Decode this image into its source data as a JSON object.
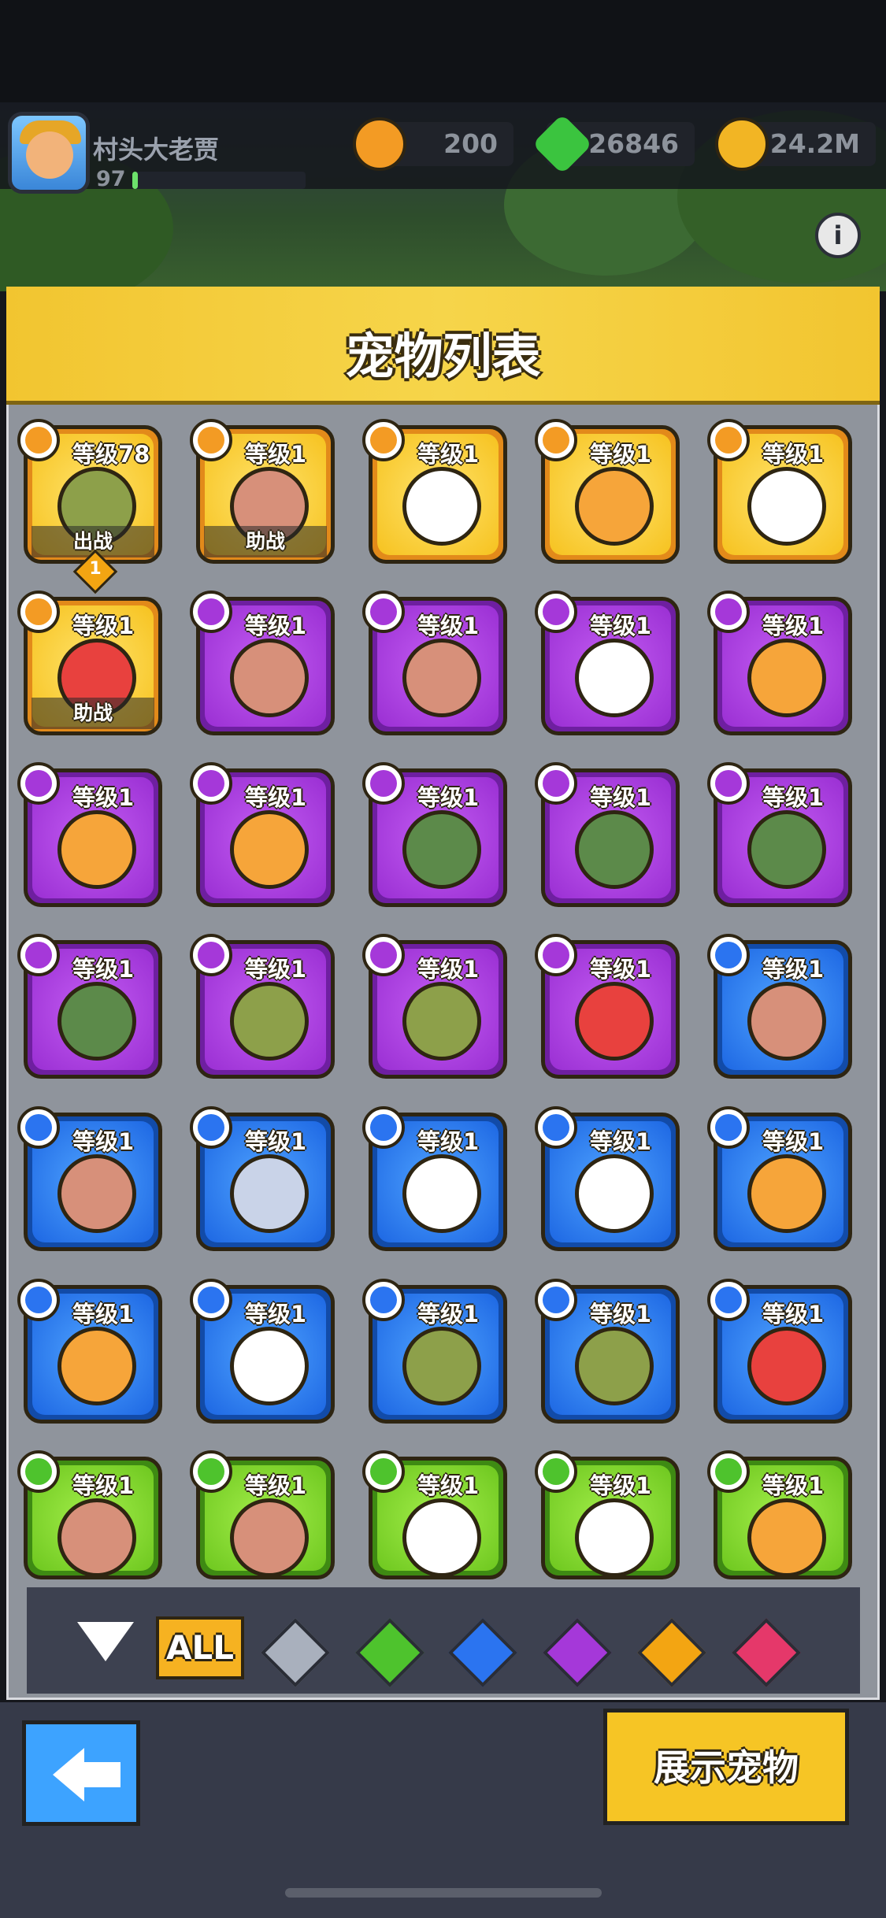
{
  "player": {
    "name": "村头大老贾",
    "level": "97",
    "xp_fraction": 0.03
  },
  "currencies": [
    {
      "name": "coin-orange",
      "value": "200",
      "color": "#f39b24"
    },
    {
      "name": "gem-green",
      "value": "26846",
      "color": "#3bc43f"
    },
    {
      "name": "coin-gold",
      "value": "24.2M",
      "color": "#f2b524"
    }
  ],
  "panel": {
    "title": "宠物列表"
  },
  "pets": [
    {
      "tier": "gold",
      "pet": "frog",
      "level": "等级78",
      "status": "出战",
      "rank": "1"
    },
    {
      "tier": "gold",
      "pet": "dog",
      "level": "等级1",
      "status": "助战"
    },
    {
      "tier": "gold",
      "pet": "robot",
      "level": "等级1"
    },
    {
      "tier": "gold",
      "pet": "fish",
      "level": "等级1"
    },
    {
      "tier": "gold",
      "pet": "eagle",
      "level": "等级1"
    },
    {
      "tier": "gold",
      "pet": "crab",
      "level": "等级1",
      "status": "助战"
    },
    {
      "tier": "purple",
      "pet": "dog",
      "level": "等级1"
    },
    {
      "tier": "purple",
      "pet": "dog",
      "level": "等级1"
    },
    {
      "tier": "purple",
      "pet": "robot",
      "level": "等级1"
    },
    {
      "tier": "purple",
      "pet": "fish",
      "level": "等级1"
    },
    {
      "tier": "purple",
      "pet": "fish",
      "level": "等级1"
    },
    {
      "tier": "purple",
      "pet": "fish",
      "level": "等级1"
    },
    {
      "tier": "purple",
      "pet": "turtle",
      "level": "等级1"
    },
    {
      "tier": "purple",
      "pet": "turtle",
      "level": "等级1"
    },
    {
      "tier": "purple",
      "pet": "turtle",
      "level": "等级1"
    },
    {
      "tier": "purple",
      "pet": "turtle",
      "level": "等级1"
    },
    {
      "tier": "purple",
      "pet": "frog",
      "level": "等级1"
    },
    {
      "tier": "purple",
      "pet": "frog",
      "level": "等级1"
    },
    {
      "tier": "purple",
      "pet": "crab",
      "level": "等级1"
    },
    {
      "tier": "blue",
      "pet": "dog",
      "level": "等级1"
    },
    {
      "tier": "blue",
      "pet": "dog",
      "level": "等级1"
    },
    {
      "tier": "blue",
      "pet": "cat",
      "level": "等级1"
    },
    {
      "tier": "blue",
      "pet": "robot",
      "level": "等级1"
    },
    {
      "tier": "blue",
      "pet": "robot",
      "level": "等级1"
    },
    {
      "tier": "blue",
      "pet": "fish",
      "level": "等级1"
    },
    {
      "tier": "blue",
      "pet": "fish",
      "level": "等级1"
    },
    {
      "tier": "blue",
      "pet": "eagle",
      "level": "等级1"
    },
    {
      "tier": "blue",
      "pet": "frog",
      "level": "等级1"
    },
    {
      "tier": "blue",
      "pet": "frog",
      "level": "等级1"
    },
    {
      "tier": "blue",
      "pet": "crab",
      "level": "等级1"
    },
    {
      "tier": "green",
      "pet": "dog",
      "level": "等级1"
    },
    {
      "tier": "green",
      "pet": "dog",
      "level": "等级1"
    },
    {
      "tier": "green",
      "pet": "robot",
      "level": "等级1"
    },
    {
      "tier": "green",
      "pet": "robot",
      "level": "等级1"
    },
    {
      "tier": "green",
      "pet": "fish",
      "level": "等级1"
    }
  ],
  "filters": {
    "all_label": "ALL",
    "gems": [
      {
        "name": "gray",
        "color": "#a9b0bd"
      },
      {
        "name": "green",
        "color": "#4ec32d"
      },
      {
        "name": "blue",
        "color": "#2b74f0"
      },
      {
        "name": "purple",
        "color": "#a538d9"
      },
      {
        "name": "orange",
        "color": "#f3a512"
      },
      {
        "name": "red",
        "color": "#e5386a"
      }
    ]
  },
  "buttons": {
    "show_pet": "展示宠物"
  },
  "icons": {
    "back": "back-arrow-icon",
    "info": "info-icon",
    "filter_toggle": "chevron-down-icon"
  }
}
